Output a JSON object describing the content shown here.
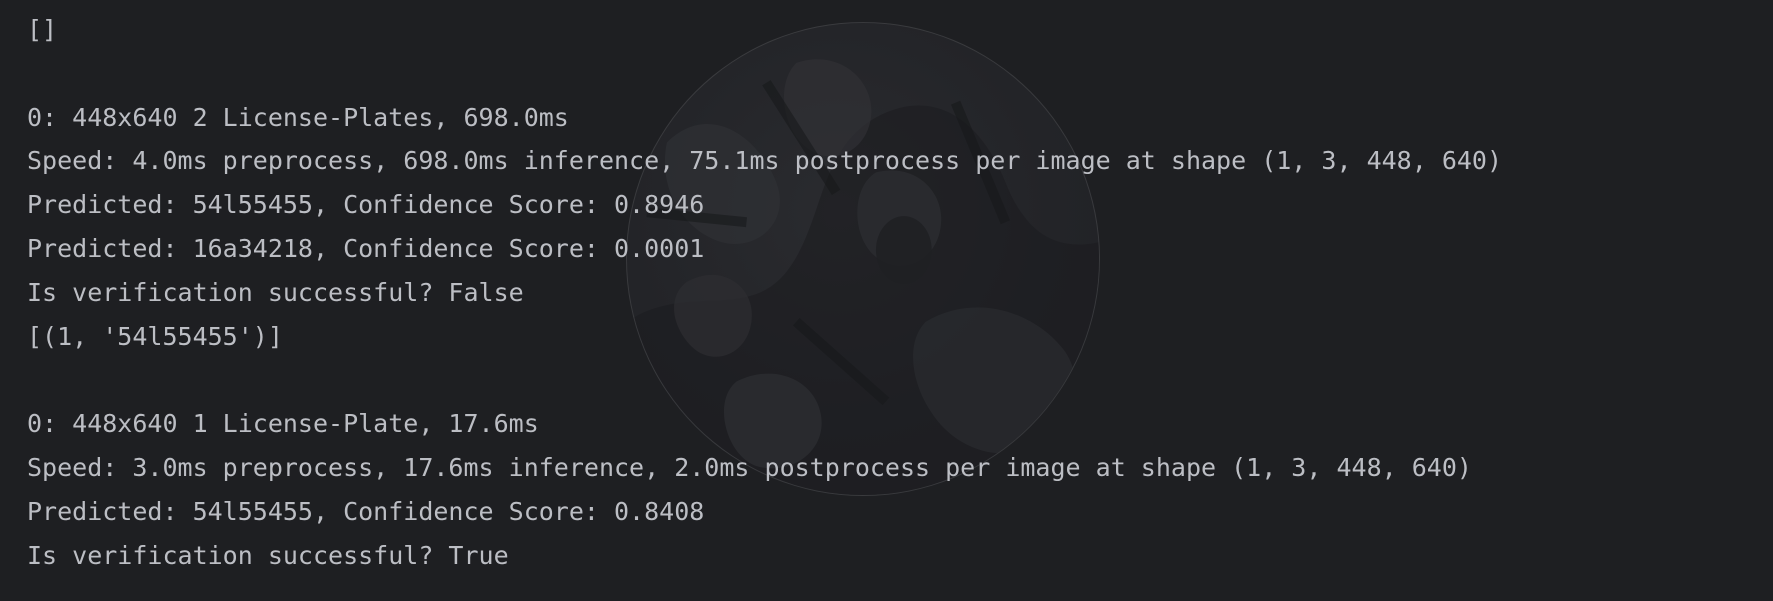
{
  "console": {
    "lines": [
      "[]",
      "",
      "0: 448x640 2 License-Plates, 698.0ms",
      "Speed: 4.0ms preprocess, 698.0ms inference, 75.1ms postprocess per image at shape (1, 3, 448, 640)",
      "Predicted: 54l55455, Confidence Score: 0.8946",
      "Predicted: 16a34218, Confidence Score: 0.0001",
      "Is verification successful? False",
      "[(1, '54l55455')]",
      "",
      "0: 448x640 1 License-Plate, 17.6ms",
      "Speed: 3.0ms preprocess, 17.6ms inference, 2.0ms postprocess per image at shape (1, 3, 448, 640)",
      "Predicted: 54l55455, Confidence Score: 0.8408",
      "Is verification successful? True"
    ]
  },
  "colors": {
    "background": "#1e1f22",
    "text": "#bcbec4"
  },
  "watermark": {
    "icon": "background-watermark-icon"
  }
}
